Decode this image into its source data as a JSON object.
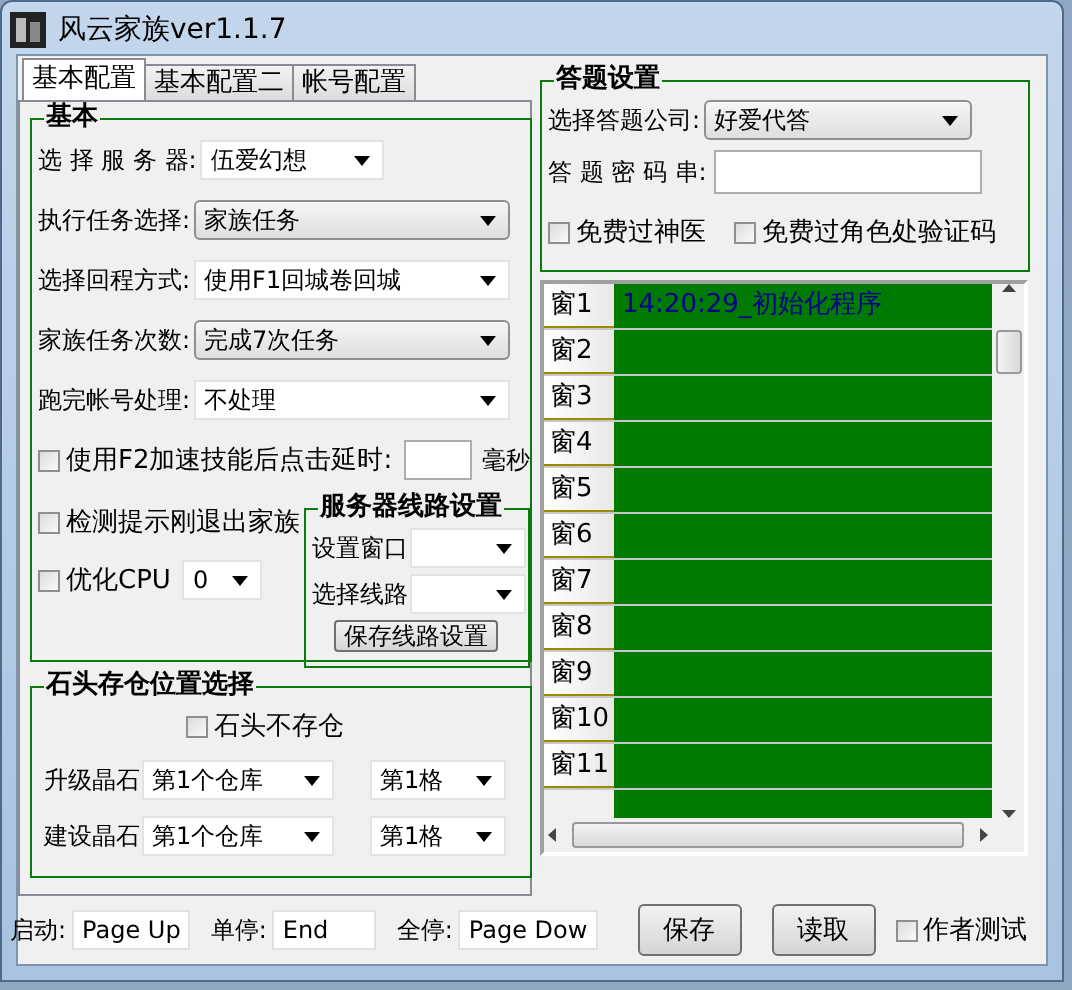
{
  "window": {
    "title": "风云家族ver1.1.7"
  },
  "tabs": [
    {
      "label": "基本配置",
      "selected": true
    },
    {
      "label": "基本配置二",
      "selected": false
    },
    {
      "label": "帐号配置",
      "selected": false
    }
  ],
  "basic": {
    "title": "基本",
    "selects": [
      {
        "label": "选 择 服 务 器:",
        "value": "伍爱幻想",
        "kind": "flat"
      },
      {
        "label": "执行任务选择:",
        "value": "家族任务",
        "kind": "raised"
      },
      {
        "label": "选择回程方式:",
        "value": "使用F1回城卷回城",
        "kind": "flat"
      },
      {
        "label": "家族任务次数:",
        "value": "完成7次任务",
        "kind": "raised"
      },
      {
        "label": "跑完帐号处理:",
        "value": "不处理",
        "kind": "flat"
      }
    ],
    "delay": {
      "label": "使用F2加速技能后点击延时:",
      "checked": false,
      "unit": "毫秒"
    },
    "detect": {
      "label": "检测提示刚退出家族",
      "checked": false
    },
    "cpu": {
      "label": "优化CPU",
      "checked": false,
      "value": "0"
    },
    "line_group": {
      "title": "服务器线路设置",
      "selects": [
        {
          "label": "设置窗口"
        },
        {
          "label": "选择线路"
        }
      ],
      "button": "保存线路设置"
    }
  },
  "stone": {
    "title": "石头存仓位置选择",
    "no_store": {
      "label": "石头不存仓",
      "checked": false
    },
    "rows": [
      {
        "label": "升级晶石",
        "warehouse": "第1个仓库",
        "slot": "第1格"
      },
      {
        "label": "建设晶石",
        "warehouse": "第1个仓库",
        "slot": "第1格"
      }
    ]
  },
  "answer": {
    "title": "答题设置",
    "company": {
      "label": "选择答题公司:",
      "value": "好爱代答"
    },
    "password": {
      "label": "答 题 密 码 串:"
    },
    "checks": [
      {
        "label": "免费过神医",
        "checked": false
      },
      {
        "label": "免费过角色处验证码",
        "checked": false
      }
    ]
  },
  "log": {
    "rows": [
      {
        "label": "窗1",
        "text": "14:20:29_初始化程序"
      },
      {
        "label": "窗2"
      },
      {
        "label": "窗3"
      },
      {
        "label": "窗4"
      },
      {
        "label": "窗5"
      },
      {
        "label": "窗6"
      },
      {
        "label": "窗7"
      },
      {
        "label": "窗8"
      },
      {
        "label": "窗9"
      },
      {
        "label": "窗10"
      },
      {
        "label": "窗11"
      }
    ]
  },
  "hotkeys": [
    {
      "label": "启动:",
      "value": "Page Up"
    },
    {
      "label": "单停:",
      "value": "End"
    },
    {
      "label": "全停:",
      "value": "Page Dow"
    }
  ],
  "buttons": [
    "保存",
    "读取"
  ],
  "author_test": {
    "label": "作者测试",
    "checked": false
  }
}
